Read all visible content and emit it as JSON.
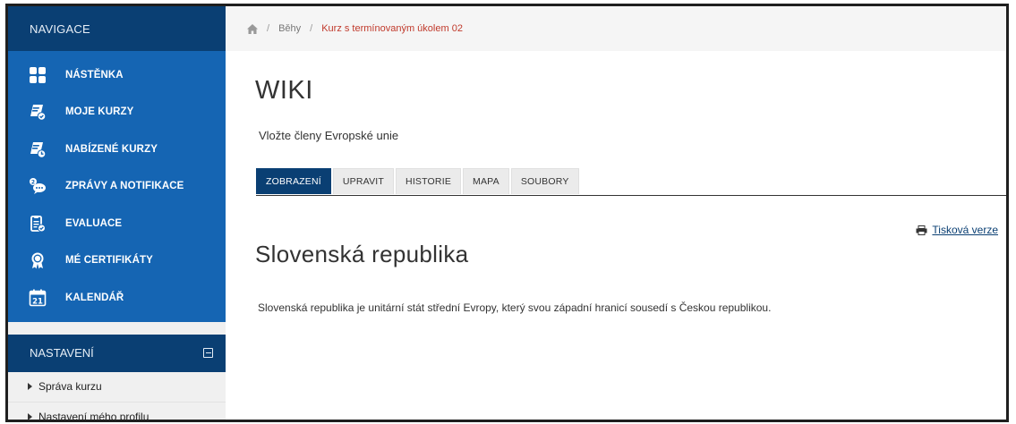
{
  "sidebar": {
    "nav_header": "NAVIGACE",
    "items": [
      {
        "label": "NÁSTĚNKA",
        "icon": "dashboard-icon"
      },
      {
        "label": "MOJE KURZY",
        "icon": "my-courses-icon"
      },
      {
        "label": "NABÍZENÉ KURZY",
        "icon": "offered-courses-icon"
      },
      {
        "label": "ZPRÁVY A NOTIFIKACE",
        "icon": "messages-icon"
      },
      {
        "label": "EVALUACE",
        "icon": "evaluation-icon"
      },
      {
        "label": "MÉ CERTIFIKÁTY",
        "icon": "certificate-icon"
      },
      {
        "label": "KALENDÁŘ",
        "icon": "calendar-icon",
        "calendar_number": "21"
      }
    ],
    "settings_header": "NASTAVENÍ",
    "settings_items": [
      {
        "label": "Správa kurzu"
      },
      {
        "label": "Nastavení mého profilu"
      }
    ]
  },
  "breadcrumb": {
    "items": [
      "Běhy",
      "Kurz s termínovaným úkolem 02"
    ]
  },
  "main": {
    "title": "WIKI",
    "subtitle": "Vložte členy Evropské unie",
    "tabs": [
      {
        "label": "ZOBRAZENÍ",
        "active": true
      },
      {
        "label": "UPRAVIT",
        "active": false
      },
      {
        "label": "HISTORIE",
        "active": false
      },
      {
        "label": "MAPA",
        "active": false
      },
      {
        "label": "SOUBORY",
        "active": false
      }
    ],
    "print_link": "Tisková verze",
    "section_title": "Slovenská republika",
    "paragraph": "Slovenská republika je unitární stát střední Evropy, který svou západní hranicí sousedí s Českou republikou."
  },
  "colors": {
    "sidebar_dark": "#0a3f73",
    "sidebar_blue": "#1565b3",
    "breadcrumb_current": "#c0392b",
    "tab_active": "#0a3f73"
  }
}
